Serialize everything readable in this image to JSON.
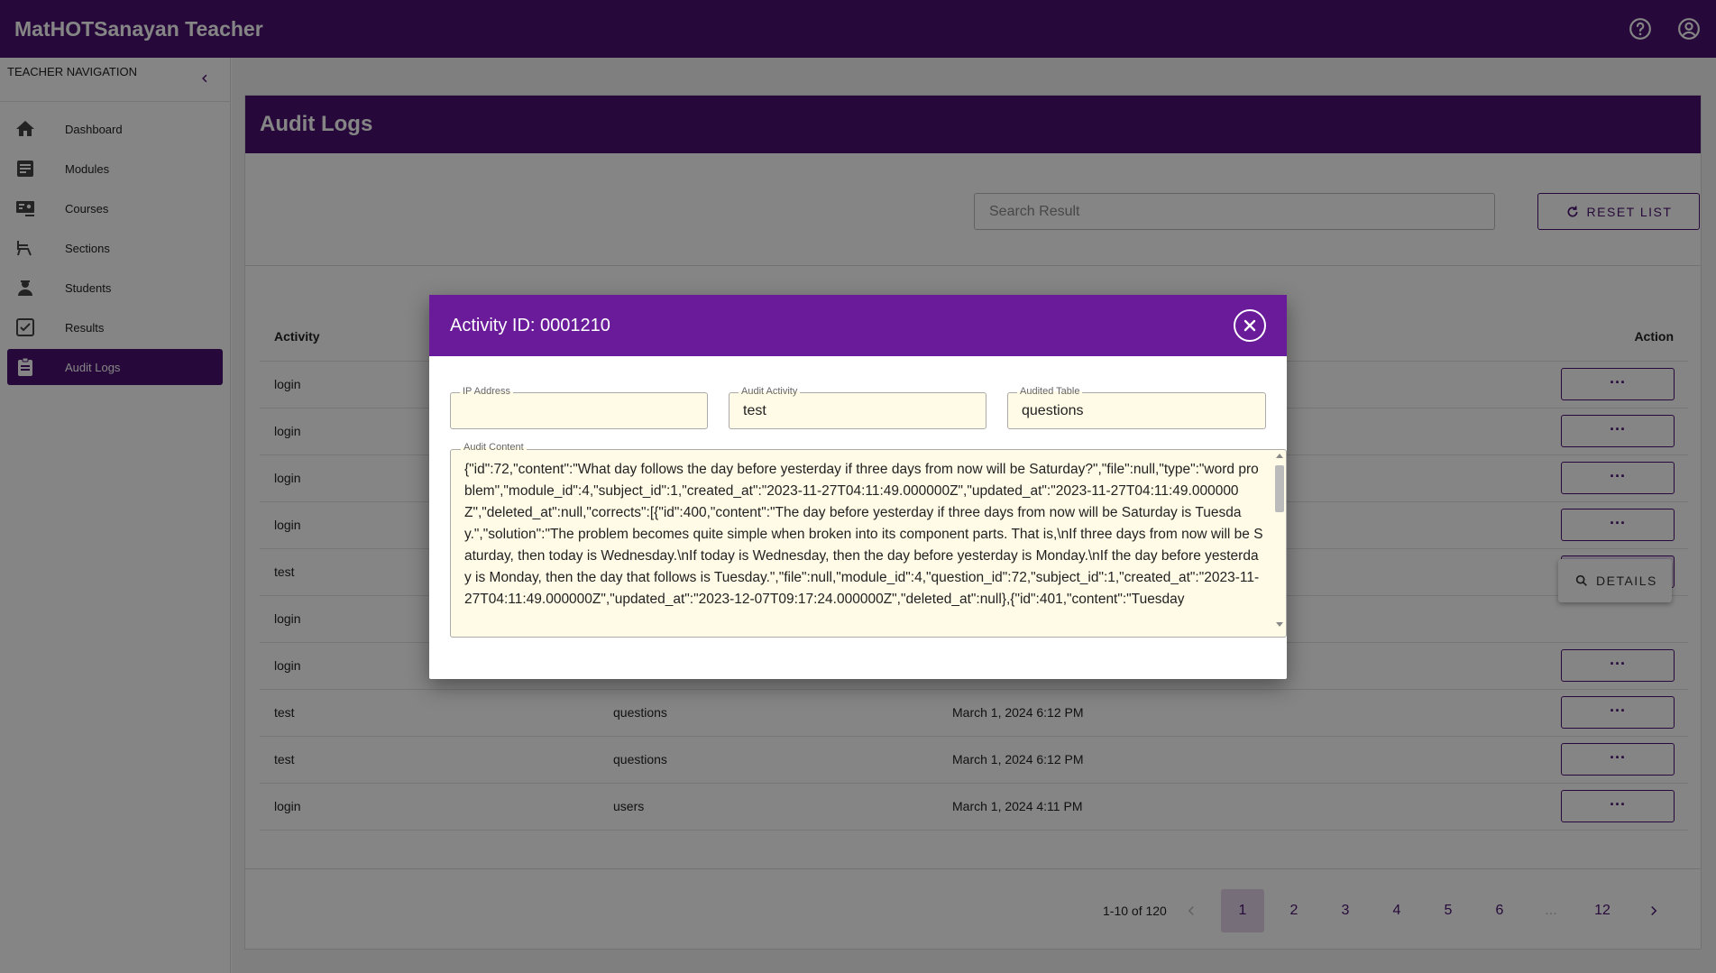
{
  "app": {
    "title": "MatHOTSanayan Teacher",
    "header_icons": [
      "help-icon",
      "account-circle-icon"
    ],
    "brand_color": "#4a1370"
  },
  "sidebar": {
    "heading": "TEACHER NAVIGATION",
    "items": [
      {
        "label": "Dashboard",
        "icon": "home-icon"
      },
      {
        "label": "Modules",
        "icon": "modules-icon"
      },
      {
        "label": "Courses",
        "icon": "courses-icon"
      },
      {
        "label": "Sections",
        "icon": "sections-icon"
      },
      {
        "label": "Students",
        "icon": "student-icon"
      },
      {
        "label": "Results",
        "icon": "results-icon"
      },
      {
        "label": "Audit Logs",
        "icon": "clipboard-icon",
        "active": true
      }
    ]
  },
  "page": {
    "title": "Audit Logs",
    "search_placeholder": "Search Result",
    "reset_label": "RESET LIST"
  },
  "table": {
    "headers": {
      "activity": "Activity",
      "action": "Action"
    },
    "rows": [
      {
        "activity": "login",
        "table": "",
        "date": ""
      },
      {
        "activity": "login",
        "table": "",
        "date": ""
      },
      {
        "activity": "login",
        "table": "",
        "date": ""
      },
      {
        "activity": "login",
        "table": "",
        "date": ""
      },
      {
        "activity": "test",
        "table": "",
        "date": ""
      },
      {
        "activity": "login",
        "table": "",
        "date": ""
      },
      {
        "activity": "login",
        "table": "",
        "date": ""
      },
      {
        "activity": "test",
        "table": "questions",
        "date": "March 1, 2024 6:12 PM"
      },
      {
        "activity": "test",
        "table": "questions",
        "date": "March 1, 2024 6:12 PM"
      },
      {
        "activity": "login",
        "table": "users",
        "date": "March 1, 2024 4:11 PM"
      }
    ],
    "action_label": "···",
    "menu": {
      "details_label": "DETAILS"
    }
  },
  "pagination": {
    "range": "1-10 of 120",
    "pages": [
      "1",
      "2",
      "3",
      "4",
      "5",
      "6",
      "...",
      "12"
    ],
    "current": "1"
  },
  "dialog": {
    "title": "Activity ID: 0001210",
    "ip_label": "IP Address",
    "ip_value": "",
    "activity_label": "Audit Activity",
    "activity_value": "test",
    "table_label": "Audited Table",
    "table_value": "questions",
    "content_label": "Audit Content",
    "content_value": "{\"id\":72,\"content\":\"What day follows the day before yesterday if three days from now will be Saturday?\",\"file\":null,\"type\":\"word problem\",\"module_id\":4,\"subject_id\":1,\"created_at\":\"2023-11-27T04:11:49.000000Z\",\"updated_at\":\"2023-11-27T04:11:49.000000Z\",\"deleted_at\":null,\"corrects\":[{\"id\":400,\"content\":\"The day before yesterday if three days from now will be Saturday is Tuesday.\",\"solution\":\"The problem becomes quite simple when broken into its component parts. That is,\\nIf three days from now will be Saturday, then today is Wednesday.\\nIf today is Wednesday, then the day before yesterday is Monday.\\nIf the day before yesterday is Monday, then the day that follows is Tuesday.\",\"file\":null,\"module_id\":4,\"question_id\":72,\"subject_id\":1,\"created_at\":\"2023-11-27T04:11:49.000000Z\",\"updated_at\":\"2023-12-07T09:17:24.000000Z\",\"deleted_at\":null},{\"id\":401,\"content\":\"Tuesday"
  }
}
